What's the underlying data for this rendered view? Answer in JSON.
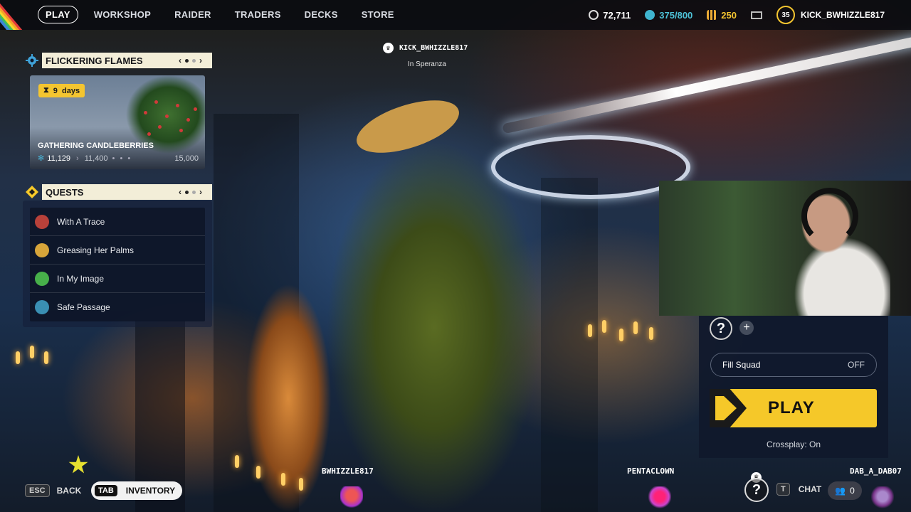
{
  "topbar": {
    "nav": [
      {
        "label": "PLAY",
        "active": true
      },
      {
        "label": "WORKSHOP"
      },
      {
        "label": "RAIDER"
      },
      {
        "label": "TRADERS"
      },
      {
        "label": "DECKS"
      },
      {
        "label": "STORE"
      }
    ],
    "currency_coins": "72,711",
    "currency_blue": "375/800",
    "currency_gold": "250",
    "player_level": "35",
    "username": "KICK_BWHIZZLE817"
  },
  "event": {
    "title": "FLICKERING FLAMES",
    "days_value": "9",
    "days_unit": "days",
    "card_title": "GATHERING CANDLEBERRIES",
    "progress_current": "11,129",
    "progress_next": "11,400",
    "progress_max": "15,000"
  },
  "quests": {
    "title": "QUESTS",
    "items": [
      {
        "label": "With A Trace",
        "color": "#b8413a"
      },
      {
        "label": "Greasing Her Palms",
        "color": "#d7a53a"
      },
      {
        "label": "In My Image",
        "color": "#47b04a"
      },
      {
        "label": "Safe Passage",
        "color": "#3a8fb3"
      }
    ]
  },
  "player_tag": {
    "name": "KICK_BWHIZZLE817",
    "location": "In Speranza"
  },
  "play_panel": {
    "fill_squad_label": "Fill Squad",
    "fill_squad_value": "OFF",
    "play_label": "PLAY",
    "crossplay": "Crossplay: On"
  },
  "bottom": {
    "esc_key": "ESC",
    "back_label": "BACK",
    "tab_key": "TAB",
    "inventory_label": "INVENTORY",
    "squad": [
      "BWHIZZLE817",
      "PENTACLOWN",
      "DAB_A_DAB07"
    ],
    "chat_key": "T",
    "chat_label": "CHAT",
    "friends_count": "0"
  },
  "colors": {
    "accent_yellow": "#f5c829",
    "accent_blue": "#3fb4cf",
    "panel_dark": "#0e1628"
  },
  "icons": [
    "crown-icon",
    "gear-icon",
    "hourglass-icon",
    "mail-icon",
    "question-icon",
    "plus-icon",
    "friends-icon",
    "chevron-left-icon",
    "chevron-right-icon"
  ]
}
